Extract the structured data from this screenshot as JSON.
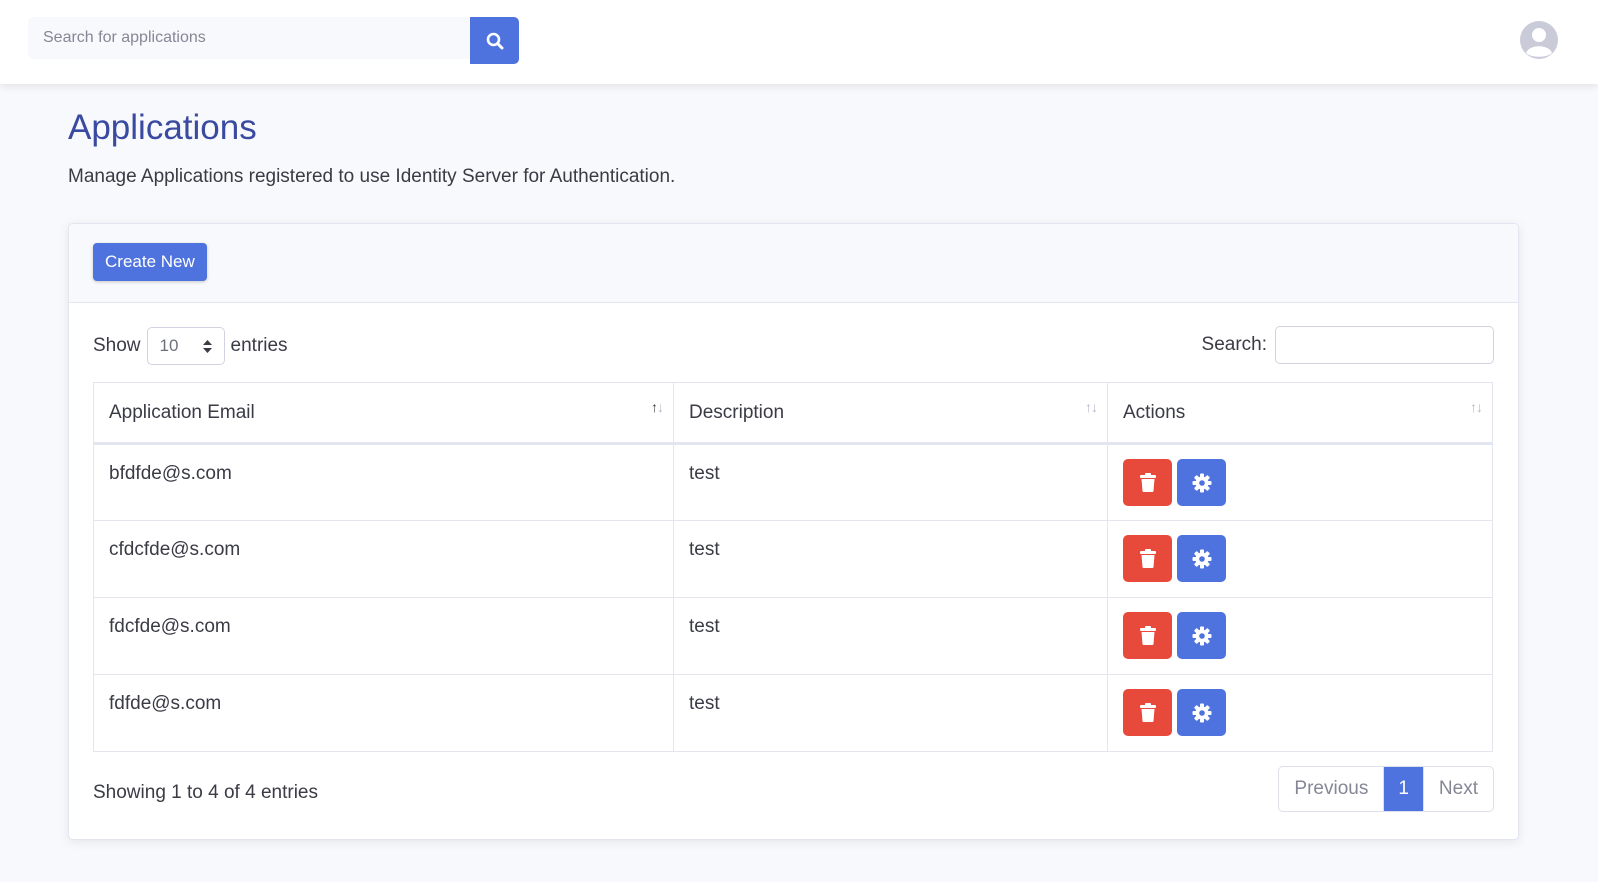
{
  "topbar": {
    "search_placeholder": "Search for applications",
    "search_icon": "search-icon",
    "avatar_icon": "user-circle-icon"
  },
  "page": {
    "title": "Applications",
    "description": "Manage Applications registered to use Identity Server for Authentication."
  },
  "card": {
    "create_label": "Create New"
  },
  "table_controls": {
    "show_label": "Show",
    "entries_label": "entries",
    "length_value": "10",
    "search_label": "Search:"
  },
  "table": {
    "columns": [
      "Application Email",
      "Description",
      "Actions"
    ],
    "rows": [
      {
        "email": "bfdfde@s.com",
        "description": "test"
      },
      {
        "email": "cfdcfde@s.com",
        "description": "test"
      },
      {
        "email": "fdcfde@s.com",
        "description": "test"
      },
      {
        "email": "fdfde@s.com",
        "description": "test"
      }
    ]
  },
  "footer": {
    "info": "Showing 1 to 4 of 4 entries",
    "previous": "Previous",
    "current_page": "1",
    "next": "Next"
  },
  "colors": {
    "primary": "#4e73df",
    "danger": "#e74a3b",
    "title": "#3a4aa0"
  }
}
